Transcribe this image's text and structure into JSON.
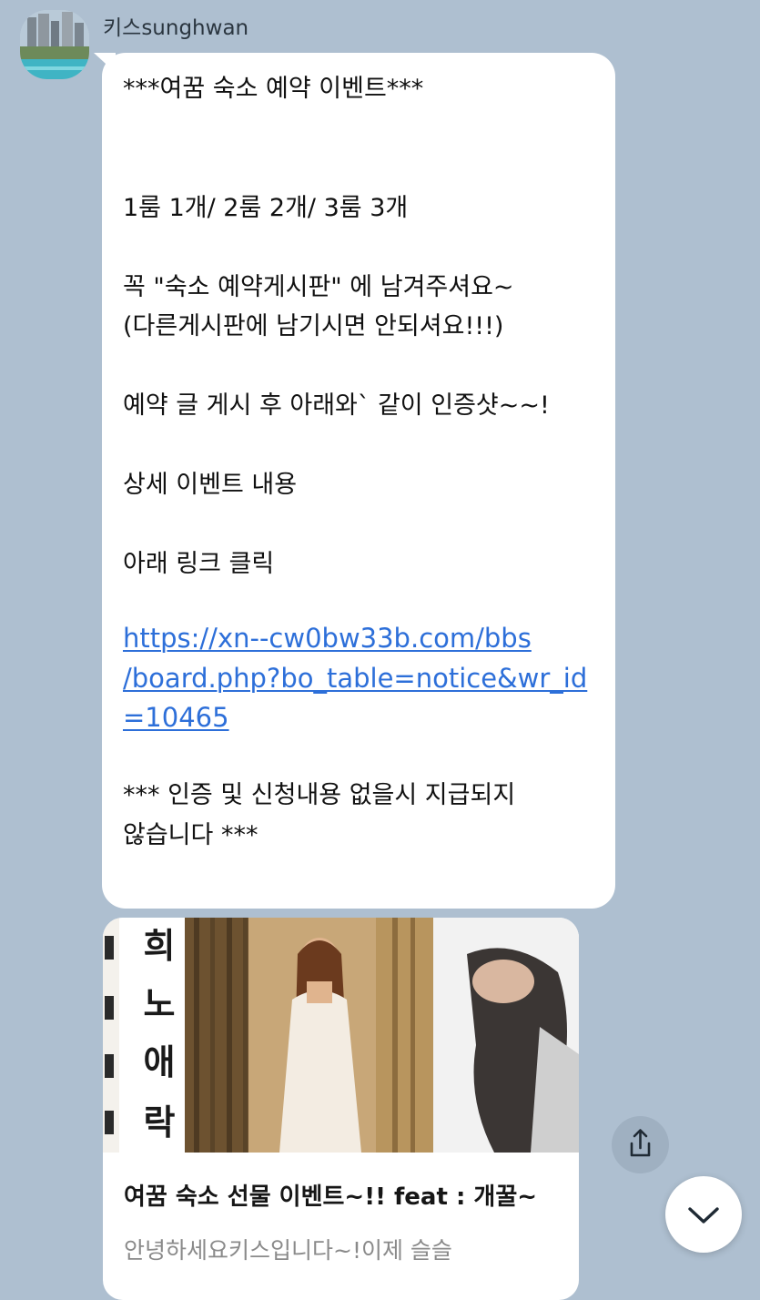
{
  "chat": {
    "sender_name": "키스sunghwan",
    "message_text": "***여꿈 숙소 예약 이벤트***\n\n\n1룸 1개/ 2룸 2개/ 3룸 3개\n\n꼭  \"숙소 예약게시판\" 에 남겨주셔요~\n(다른게시판에 남기시면 안되셔요!!!)\n\n예약 글 게시 후 아래와` 같이 인증샷~~!\n\n상세 이벤트 내용\n\n아래 링크 클릭",
    "link_lines": [
      "https://xn--cw0bw33b.com/bbs",
      "/board.php?bo_table=notice&wr_id",
      "=10465"
    ],
    "footer_text": "*** 인증 및 신청내용 없을시 지급되지\n않습니다 ***"
  },
  "link_preview": {
    "image_chars": [
      "희",
      "노",
      "애",
      "락"
    ],
    "title": "여꿈 숙소 선물 이벤트~!! feat : 개꿀~",
    "description": "안녕하세요키스입니다~!이제 슬슬"
  },
  "icons": {
    "share": "share-icon",
    "scroll_down": "chevron-down-icon"
  },
  "colors": {
    "chat_background": "#aebfd0",
    "bubble": "#ffffff",
    "link": "#2d6fd9"
  }
}
